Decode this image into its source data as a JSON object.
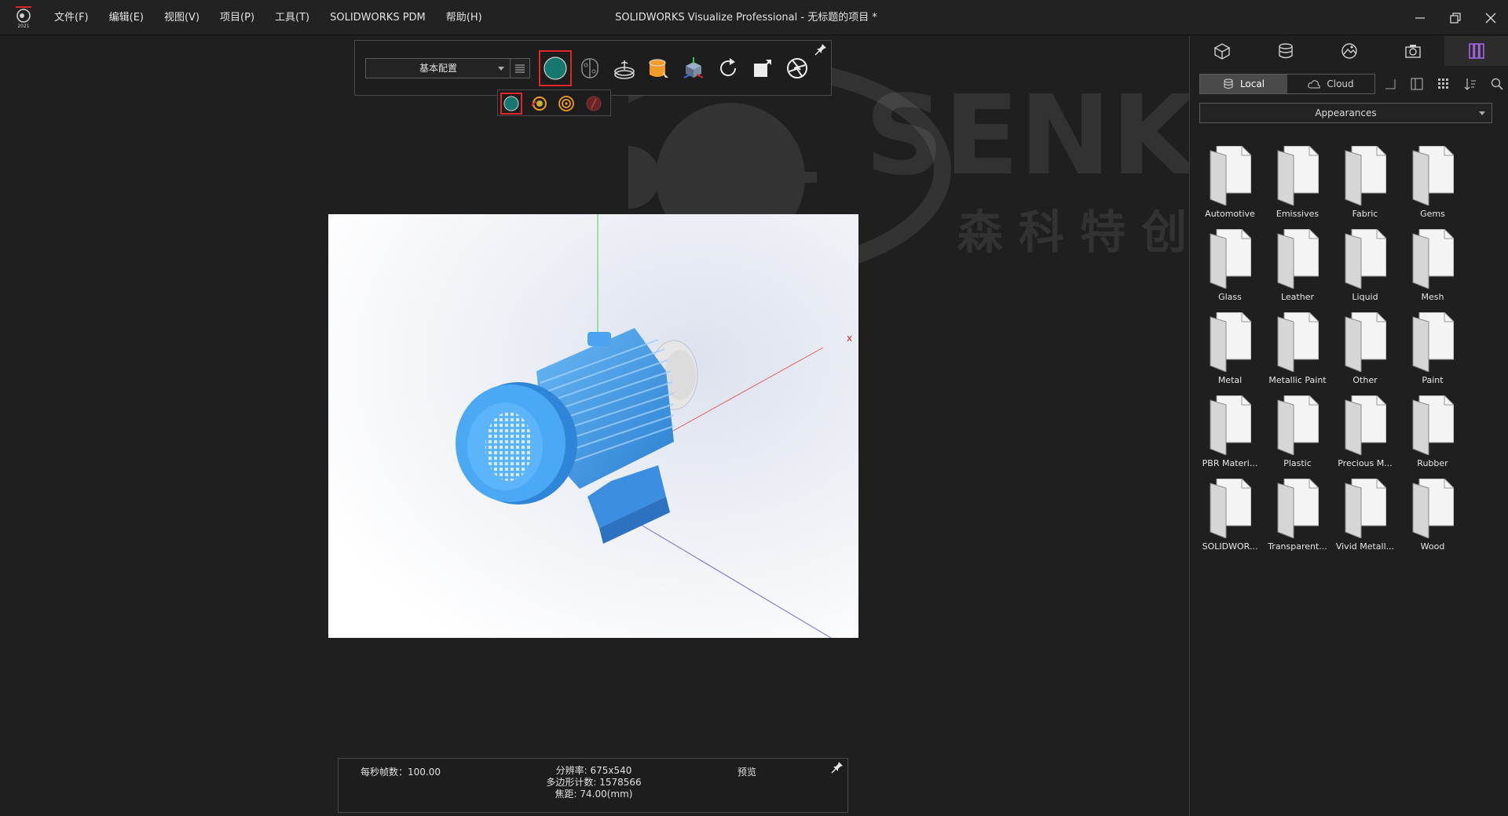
{
  "app": {
    "logo_year": "2021",
    "window_title": "SOLIDWORKS Visualize Professional - 无标题的项目 *"
  },
  "menu": [
    "文件(F)",
    "编辑(E)",
    "视图(V)",
    "项目(P)",
    "工具(T)",
    "SOLIDWORKS PDM",
    "帮助(H)"
  ],
  "toolbar": {
    "configuration": "基本配置"
  },
  "status": {
    "fps": "每秒帧数：100.00",
    "resolution": "分辨率: 675x540",
    "polygons": "多边形计数: 1578566",
    "focal_length": "焦距: 74.00(mm)",
    "render_mode": "预览"
  },
  "panel": {
    "local_label": "Local",
    "cloud_label": "Cloud",
    "category": "Appearances",
    "folders": [
      "Automotive",
      "Emissives",
      "Fabric",
      "Gems",
      "Glass",
      "Leather",
      "Liquid",
      "Mesh",
      "Metal",
      "Metallic Paint",
      "Other",
      "Paint",
      "PBR Materi...",
      "Plastic",
      "Precious M...",
      "Rubber",
      "SOLIDWOR...",
      "Transparent...",
      "Vivid Metall...",
      "Wood"
    ]
  },
  "viewport": {
    "axis_label_x": "x",
    "watermark_text": "SENKE",
    "watermark_cn": "森 科 特 创"
  },
  "colors": {
    "accent_selected": "#e0262a",
    "motor_blue": "#3fa0f0",
    "panel_tab_active": "#a565e0"
  }
}
